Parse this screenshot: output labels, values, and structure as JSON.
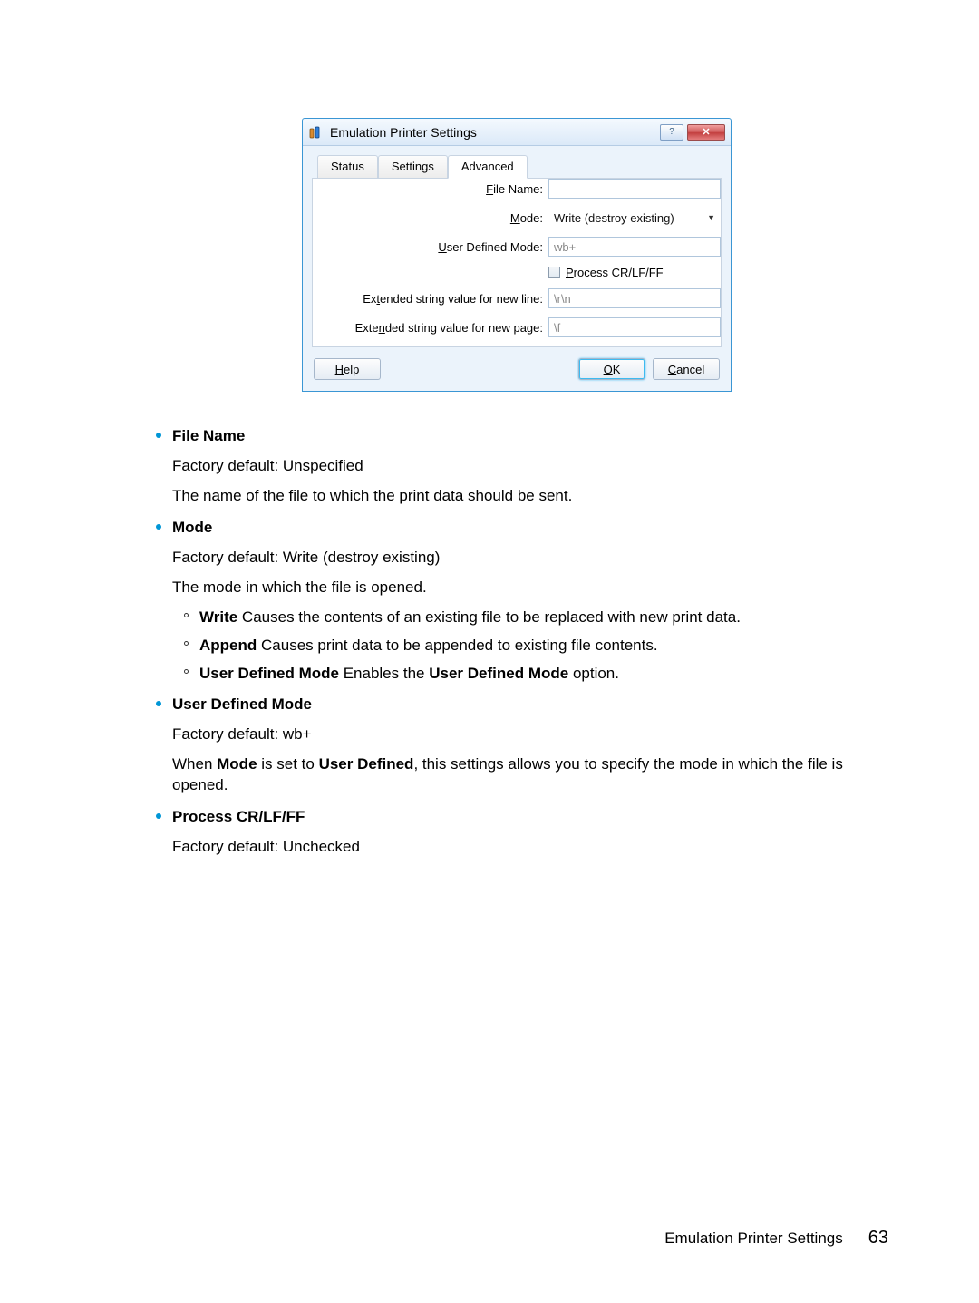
{
  "dialog": {
    "title": "Emulation Printer Settings",
    "tabs": [
      "Status",
      "Settings",
      "Advanced"
    ],
    "active_tab": 2,
    "fields": {
      "file_name": {
        "label": "File Name:",
        "value": ""
      },
      "mode": {
        "label": "Mode:",
        "value": "Write (destroy existing)"
      },
      "user_defined_mode": {
        "label": "User Defined Mode:",
        "value": "wb+"
      },
      "process_cr": {
        "label": "Process CR/LF/FF",
        "checked": false
      },
      "ext_newline": {
        "label": "Extended string value for new line:",
        "value": "\\r\\n"
      },
      "ext_newpage": {
        "label": "Extended string value for new page:",
        "value": "\\f"
      }
    },
    "buttons": {
      "help": "Help",
      "ok": "OK",
      "cancel": "Cancel"
    }
  },
  "doc": {
    "items": [
      {
        "title": "File Name",
        "lines": [
          "Factory default: Unspecified",
          "The name of the file to which the print data should be sent."
        ],
        "subs": []
      },
      {
        "title": "Mode",
        "lines": [
          "Factory default: Write (destroy existing)",
          "The mode in which the file is opened."
        ],
        "subs": [
          {
            "b": "Write",
            "t": " Causes the contents of an existing file to be replaced with new print data."
          },
          {
            "b": "Append",
            "t": " Causes print data to be appended to existing file contents."
          },
          {
            "b": "User Defined Mode",
            "t_pre": " Enables the ",
            "b2": "User Defined Mode",
            "t_post": " option."
          }
        ]
      },
      {
        "title": "User Defined Mode",
        "lines": [
          "Factory default: wb+"
        ],
        "inline": {
          "pre": "When ",
          "b1": "Mode",
          "mid": " is set to ",
          "b2": "User Defined",
          "post": ", this settings allows you to specify the mode in which the file is opened."
        },
        "subs": []
      },
      {
        "title": "Process CR/LF/FF",
        "lines": [
          "Factory default: Unchecked"
        ],
        "subs": []
      }
    ]
  },
  "footer": {
    "title": "Emulation Printer Settings",
    "page": "63"
  }
}
